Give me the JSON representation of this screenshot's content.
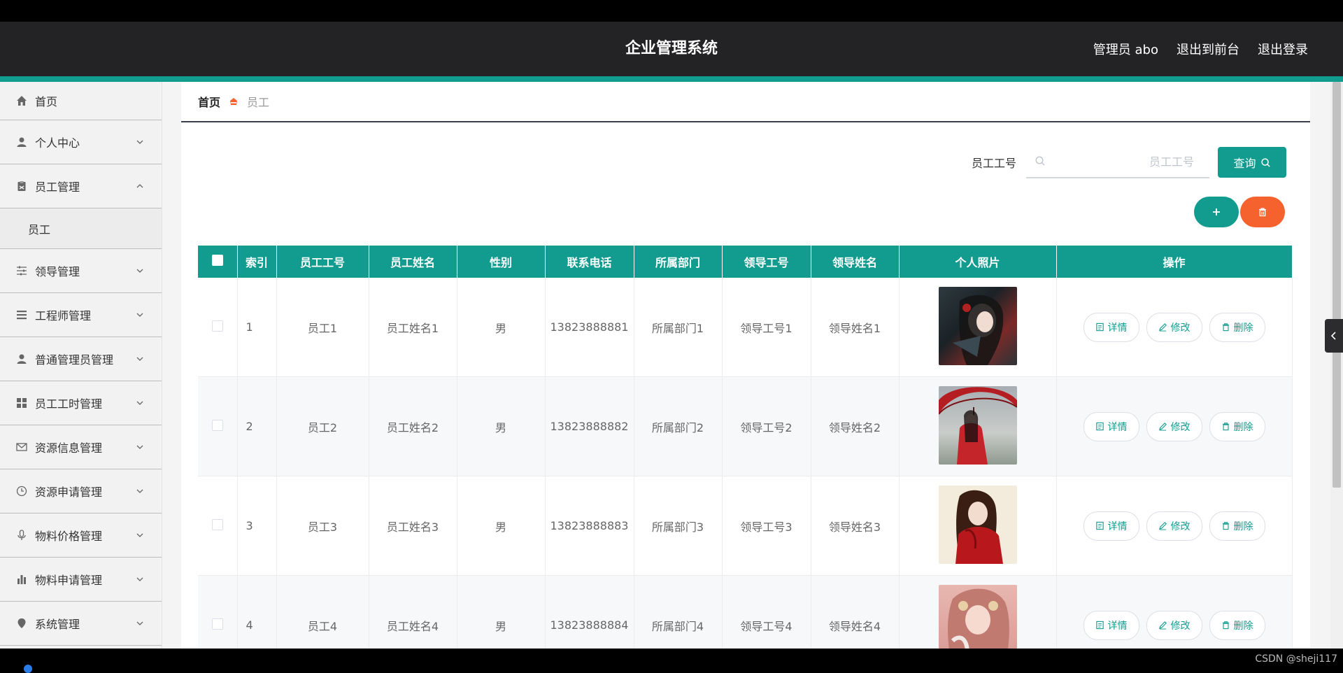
{
  "header": {
    "title": "企业管理系统",
    "admin": "管理员 abo",
    "front": "退出到前台",
    "logout": "退出登录"
  },
  "sidebar": {
    "home": "首页",
    "personal": "个人中心",
    "employee_mgmt": "员工管理",
    "employee_sub": "员工",
    "leader_mgmt": "领导管理",
    "engineer_mgmt": "工程师管理",
    "admin_mgmt": "普通管理员管理",
    "hours_mgmt": "员工工时管理",
    "resource_info": "资源信息管理",
    "resource_apply": "资源申请管理",
    "material_price": "物料价格管理",
    "material_apply": "物料申请管理",
    "system_mgmt": "系统管理"
  },
  "breadcrumb": {
    "home": "首页",
    "current": "员工"
  },
  "search": {
    "label": "员工工号",
    "placeholder": "员工工号",
    "button": "查询"
  },
  "table": {
    "headers": [
      "索引",
      "员工工号",
      "员工姓名",
      "性别",
      "联系电话",
      "所属部门",
      "领导工号",
      "领导姓名",
      "个人照片",
      "操作"
    ],
    "rows": [
      {
        "index": "1",
        "id": "员工1",
        "name": "员工姓名1",
        "gender": "男",
        "phone": "13823888881",
        "dept": "所属部门1",
        "leader_id": "领导工号1",
        "leader_name": "领导姓名1"
      },
      {
        "index": "2",
        "id": "员工2",
        "name": "员工姓名2",
        "gender": "男",
        "phone": "13823888882",
        "dept": "所属部门2",
        "leader_id": "领导工号2",
        "leader_name": "领导姓名2"
      },
      {
        "index": "3",
        "id": "员工3",
        "name": "员工姓名3",
        "gender": "男",
        "phone": "13823888883",
        "dept": "所属部门3",
        "leader_id": "领导工号3",
        "leader_name": "领导姓名3"
      },
      {
        "index": "4",
        "id": "员工4",
        "name": "员工姓名4",
        "gender": "男",
        "phone": "13823888884",
        "dept": "所属部门4",
        "leader_id": "领导工号4",
        "leader_name": "领导姓名4"
      }
    ],
    "actions": {
      "detail": "详情",
      "edit": "修改",
      "delete": "删除"
    }
  },
  "footer": {
    "watermark": "CSDN @sheji117"
  },
  "colors": {
    "accent": "#129b8f",
    "danger": "#f5622e",
    "topbar": "#232326"
  }
}
